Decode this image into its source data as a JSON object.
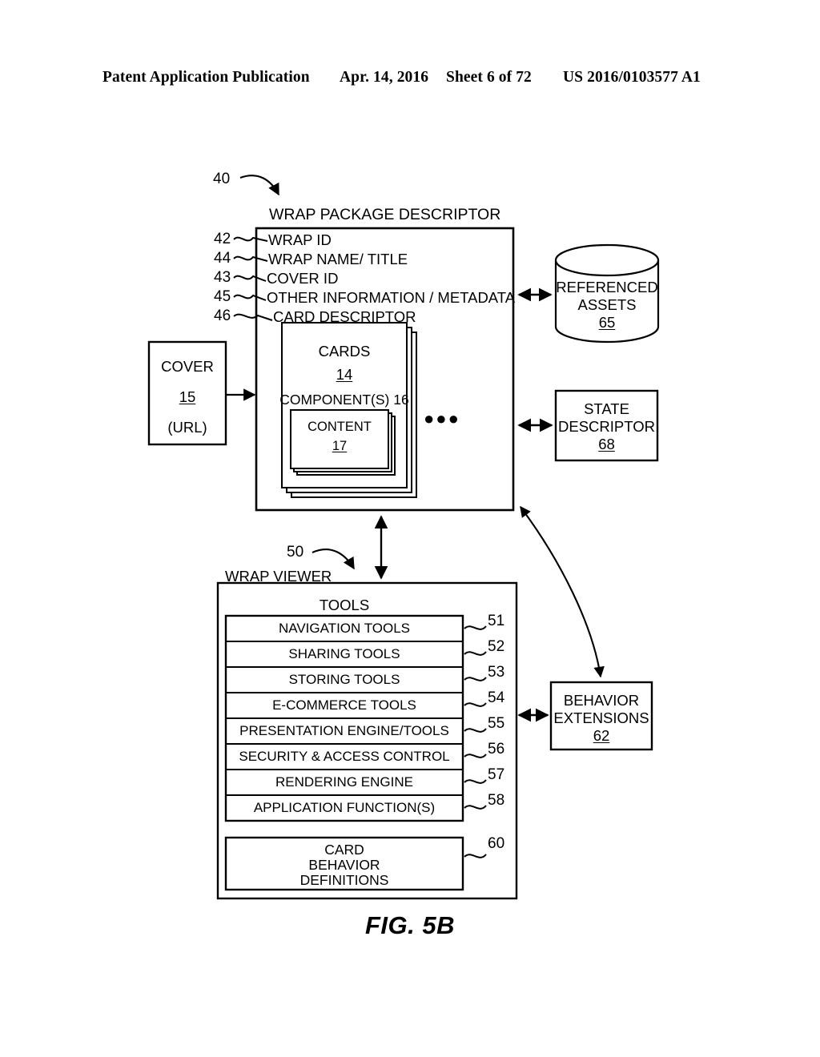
{
  "header": {
    "publication": "Patent Application Publication",
    "date": "Apr. 14, 2016",
    "sheet": "Sheet 6 of 72",
    "patent_number": "US 2016/0103577 A1"
  },
  "figure": {
    "caption": "FIG. 5B"
  },
  "wrap_package_descriptor": {
    "title": "WRAP PACKAGE DESCRIPTOR",
    "ref": "40",
    "fields": [
      {
        "ref": "42",
        "label": "WRAP ID"
      },
      {
        "ref": "44",
        "label": "WRAP NAME/ TITLE"
      },
      {
        "ref": "43",
        "label": "COVER ID"
      },
      {
        "ref": "45",
        "label": "OTHER INFORMATION / METADATA"
      },
      {
        "ref": "46",
        "label": "CARD DESCRIPTOR"
      }
    ],
    "cards": {
      "title": "CARDS",
      "ref": "14",
      "components_label": "COMPONENT(S) 16",
      "content": {
        "title": "CONTENT",
        "ref": "17"
      },
      "ellipsis": "●●●"
    }
  },
  "cover": {
    "title": "COVER",
    "ref": "15",
    "subtitle": "(URL)"
  },
  "referenced_assets": {
    "line1": "REFERENCED",
    "line2": "ASSETS",
    "ref": "65"
  },
  "state_descriptor": {
    "line1": "STATE",
    "line2": "DESCRIPTOR",
    "ref": "68"
  },
  "behavior_extensions": {
    "line1": "BEHAVIOR",
    "line2": "EXTENSIONS",
    "ref": "62"
  },
  "wrap_viewer": {
    "title": "WRAP VIEWER",
    "ref": "50",
    "tools_heading": "TOOLS",
    "tools": [
      {
        "ref": "51",
        "label": "NAVIGATION TOOLS"
      },
      {
        "ref": "52",
        "label": "SHARING TOOLS"
      },
      {
        "ref": "53",
        "label": "STORING TOOLS"
      },
      {
        "ref": "54",
        "label": "E-COMMERCE TOOLS"
      },
      {
        "ref": "55",
        "label": "PRESENTATION ENGINE/TOOLS"
      },
      {
        "ref": "56",
        "label": "SECURITY & ACCESS CONTROL"
      },
      {
        "ref": "57",
        "label": "RENDERING ENGINE"
      },
      {
        "ref": "58",
        "label": "APPLICATION FUNCTION(S)"
      }
    ],
    "card_behavior_definitions": {
      "ref": "60",
      "line1": "CARD",
      "line2": "BEHAVIOR",
      "line3": "DEFINITIONS"
    }
  }
}
